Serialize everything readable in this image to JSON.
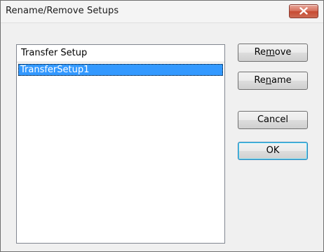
{
  "window": {
    "title": "Rename/Remove Setups"
  },
  "list": {
    "column_header": "Transfer Setup",
    "items": [
      {
        "label": "TransferSetup1",
        "selected": true
      }
    ]
  },
  "buttons": {
    "remove": {
      "pre": "Re",
      "accel": "m",
      "post": "ove"
    },
    "rename": {
      "pre": "Re",
      "accel": "n",
      "post": "ame"
    },
    "cancel": "Cancel",
    "ok": "OK"
  },
  "colors": {
    "selection": "#3399ff",
    "close_button": "#c74b33"
  },
  "icons": {
    "close": "close-icon"
  }
}
